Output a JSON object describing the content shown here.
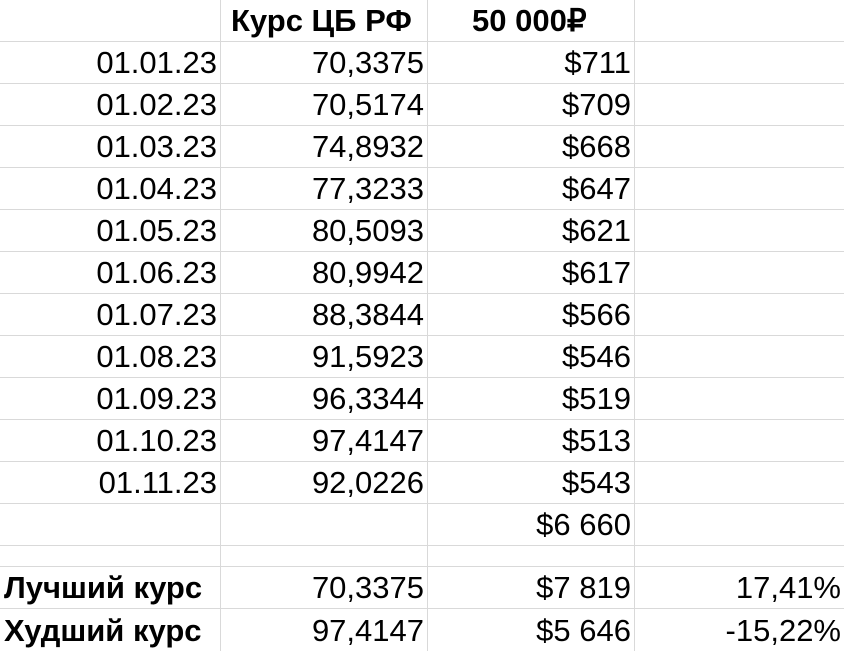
{
  "header": {
    "rate_label": "Курс ЦБ РФ",
    "amount_label": "50 000₽"
  },
  "rows": [
    {
      "date": "01.01.23",
      "rate": "70,3375",
      "usd": "$711"
    },
    {
      "date": "01.02.23",
      "rate": "70,5174",
      "usd": "$709"
    },
    {
      "date": "01.03.23",
      "rate": "74,8932",
      "usd": "$668"
    },
    {
      "date": "01.04.23",
      "rate": "77,3233",
      "usd": "$647"
    },
    {
      "date": "01.05.23",
      "rate": "80,5093",
      "usd": "$621"
    },
    {
      "date": "01.06.23",
      "rate": "80,9942",
      "usd": "$617"
    },
    {
      "date": "01.07.23",
      "rate": "88,3844",
      "usd": "$566"
    },
    {
      "date": "01.08.23",
      "rate": "91,5923",
      "usd": "$546"
    },
    {
      "date": "01.09.23",
      "rate": "96,3344",
      "usd": "$519"
    },
    {
      "date": "01.10.23",
      "rate": "97,4147",
      "usd": "$513"
    },
    {
      "date": "01.11.23",
      "rate": "92,0226",
      "usd": "$543"
    }
  ],
  "total": {
    "usd": "$6 660"
  },
  "best": {
    "label": "Лучший курс",
    "rate": "70,3375",
    "usd": "$7 819",
    "pct": "17,41%"
  },
  "worst": {
    "label": "Худший курс",
    "rate": "97,4147",
    "usd": "$5 646",
    "pct": "-15,22%"
  }
}
